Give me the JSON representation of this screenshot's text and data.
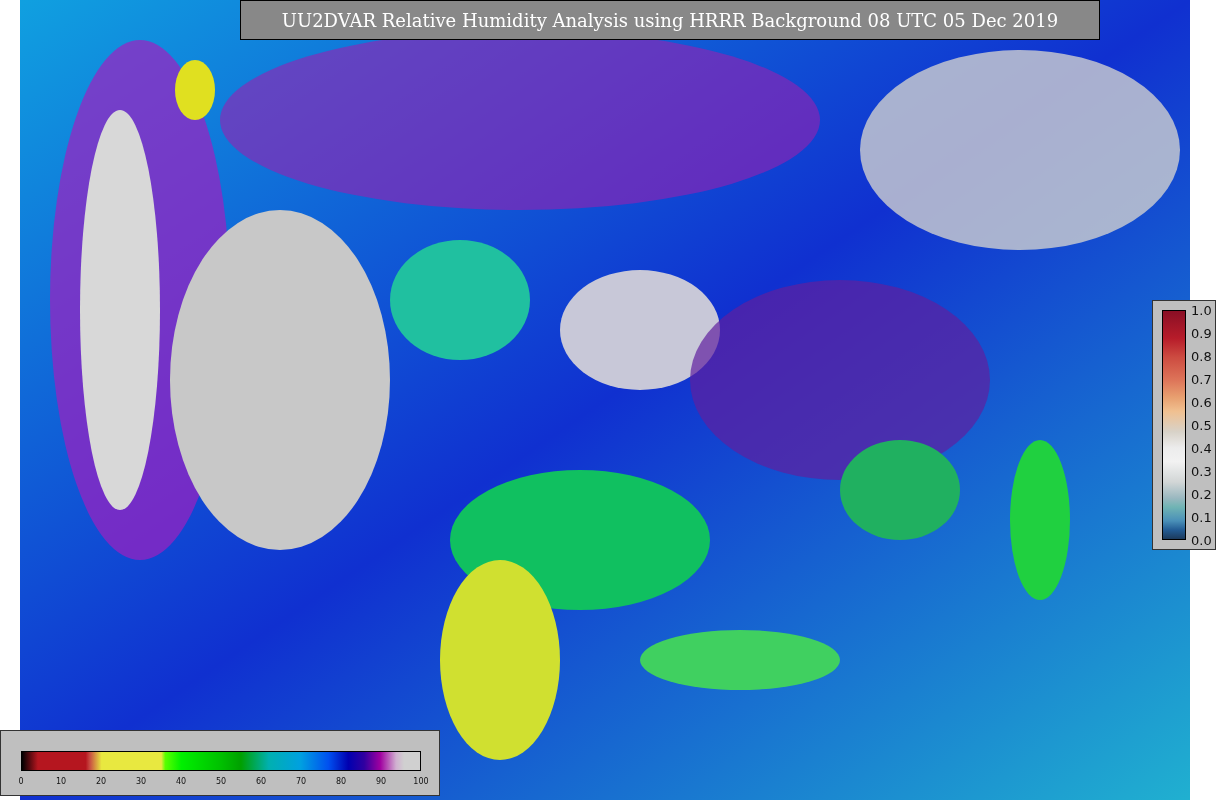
{
  "title": "UU2DVAR Relative Humidity Analysis using HRRR Background 08 UTC 05 Dec 2019",
  "humidity_colorbar": {
    "ticks": [
      "0",
      "10",
      "20",
      "30",
      "40",
      "50",
      "60",
      "70",
      "80",
      "90",
      "100"
    ]
  },
  "weight_colorbar": {
    "ticks": [
      "1.0",
      "0.9",
      "0.8",
      "0.7",
      "0.6",
      "0.5",
      "0.4",
      "0.3",
      "0.2",
      "0.1",
      "0.0"
    ]
  }
}
